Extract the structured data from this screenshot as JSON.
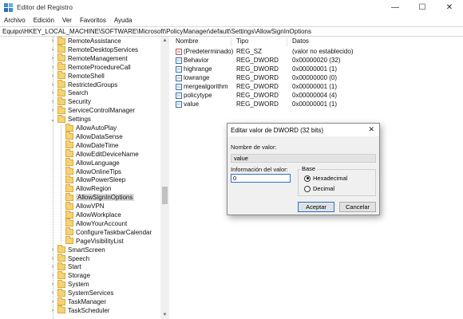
{
  "window": {
    "title": "Editor del Registro",
    "controls": {
      "minimize": "—",
      "maximize": "☐",
      "close": "✕"
    }
  },
  "menu": [
    "Archivo",
    "Edición",
    "Ver",
    "Favoritos",
    "Ayuda"
  ],
  "address": "Equipo\\HKEY_LOCAL_MACHINE\\SOFTWARE\\Microsoft\\PolicyManager\\default\\Settings\\AllowSignInOptions",
  "tree": {
    "items": [
      {
        "label": "RemoteAssistance",
        "twisty": "›",
        "level": 0
      },
      {
        "label": "RemoteDesktopServices",
        "twisty": "›",
        "level": 0
      },
      {
        "label": "RemoteManagement",
        "twisty": "›",
        "level": 0
      },
      {
        "label": "RemoteProcedureCall",
        "twisty": "›",
        "level": 0
      },
      {
        "label": "RemoteShell",
        "twisty": "›",
        "level": 0
      },
      {
        "label": "RestrictedGroups",
        "twisty": "›",
        "level": 0
      },
      {
        "label": "Search",
        "twisty": "›",
        "level": 0
      },
      {
        "label": "Security",
        "twisty": "›",
        "level": 0
      },
      {
        "label": "ServiceControlManager",
        "twisty": "›",
        "level": 0
      },
      {
        "label": "Settings",
        "twisty": "⌄",
        "level": 0
      },
      {
        "label": "AllowAutoPlay",
        "twisty": "",
        "level": 1
      },
      {
        "label": "AllowDataSense",
        "twisty": "",
        "level": 1
      },
      {
        "label": "AllowDateTime",
        "twisty": "",
        "level": 1
      },
      {
        "label": "AllowEditDeviceName",
        "twisty": "",
        "level": 1
      },
      {
        "label": "AllowLanguage",
        "twisty": "",
        "level": 1
      },
      {
        "label": "AllowOnlineTips",
        "twisty": "",
        "level": 1
      },
      {
        "label": "AllowPowerSleep",
        "twisty": "",
        "level": 1
      },
      {
        "label": "AllowRegion",
        "twisty": "",
        "level": 1
      },
      {
        "label": "AllowSignInOptions",
        "twisty": "",
        "level": 1,
        "selected": true
      },
      {
        "label": "AllowVPN",
        "twisty": "",
        "level": 1
      },
      {
        "label": "AllowWorkplace",
        "twisty": "",
        "level": 1
      },
      {
        "label": "AllowYourAccount",
        "twisty": "",
        "level": 1
      },
      {
        "label": "ConfigureTaskbarCalendar",
        "twisty": "",
        "level": 1
      },
      {
        "label": "PageVisibilityList",
        "twisty": "",
        "level": 1
      },
      {
        "label": "SmartScreen",
        "twisty": "›",
        "level": 0
      },
      {
        "label": "Speech",
        "twisty": "›",
        "level": 0
      },
      {
        "label": "Start",
        "twisty": "›",
        "level": 0
      },
      {
        "label": "Storage",
        "twisty": "›",
        "level": 0
      },
      {
        "label": "System",
        "twisty": "›",
        "level": 0
      },
      {
        "label": "SystemServices",
        "twisty": "›",
        "level": 0
      },
      {
        "label": "TaskManager",
        "twisty": "›",
        "level": 0
      },
      {
        "label": "TaskScheduler",
        "twisty": "›",
        "level": 0
      }
    ]
  },
  "list": {
    "headers": {
      "name": "Nombre",
      "type": "Tipo",
      "data": "Datos"
    },
    "rows": [
      {
        "icon": "ab",
        "kind": "sz",
        "name": "(Predeterminado)",
        "type": "REG_SZ",
        "data": "(valor no establecido)"
      },
      {
        "icon": "01",
        "kind": "dw",
        "name": "Behavior",
        "type": "REG_DWORD",
        "data": "0x00000020 (32)"
      },
      {
        "icon": "01",
        "kind": "dw",
        "name": "highrange",
        "type": "REG_DWORD",
        "data": "0x00000001 (1)"
      },
      {
        "icon": "01",
        "kind": "dw",
        "name": "lowrange",
        "type": "REG_DWORD",
        "data": "0x00000000 (0)"
      },
      {
        "icon": "01",
        "kind": "dw",
        "name": "mergealgorithm",
        "type": "REG_DWORD",
        "data": "0x00000001 (1)"
      },
      {
        "icon": "01",
        "kind": "dw",
        "name": "policytype",
        "type": "REG_DWORD",
        "data": "0x00000004 (4)"
      },
      {
        "icon": "01",
        "kind": "dw",
        "name": "value",
        "type": "REG_DWORD",
        "data": "0x00000001 (1)"
      }
    ]
  },
  "dialog": {
    "title": "Editar valor de DWORD (32 bits)",
    "close": "✕",
    "name_label": "Nombre de valor:",
    "name_value": "value",
    "data_label": "Información del valor:",
    "data_value": "0",
    "base_label": "Base",
    "radio_hex": "Hexadecimal",
    "radio_dec": "Decimal",
    "ok": "Aceptar",
    "cancel": "Cancelar"
  },
  "colors": {
    "folder": "#f6d271",
    "selection": "#d9d9d9",
    "focus": "#2a73d0"
  }
}
